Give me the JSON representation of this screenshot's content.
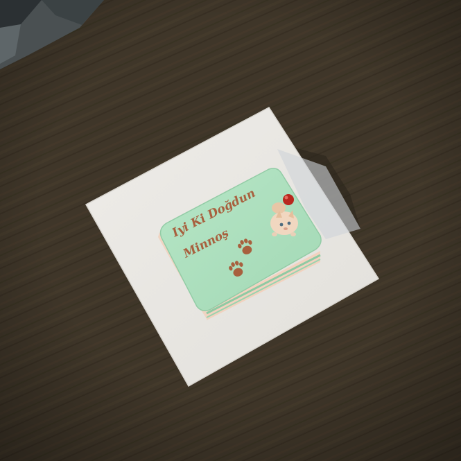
{
  "cake": {
    "inscription_line1": "Iyi Ki Doğdun",
    "inscription_line2": "Minnoş",
    "icing_color": "#a8dcba",
    "lettering_color": "#a8603e"
  },
  "colors": {
    "table": "#3f3629",
    "board": "#e9e7e2",
    "icing": "#a8dcba",
    "lettering": "#a8603e"
  },
  "decorations": [
    "paw-print-icon",
    "paw-print-icon",
    "kitten-figurine",
    "red-ball"
  ]
}
